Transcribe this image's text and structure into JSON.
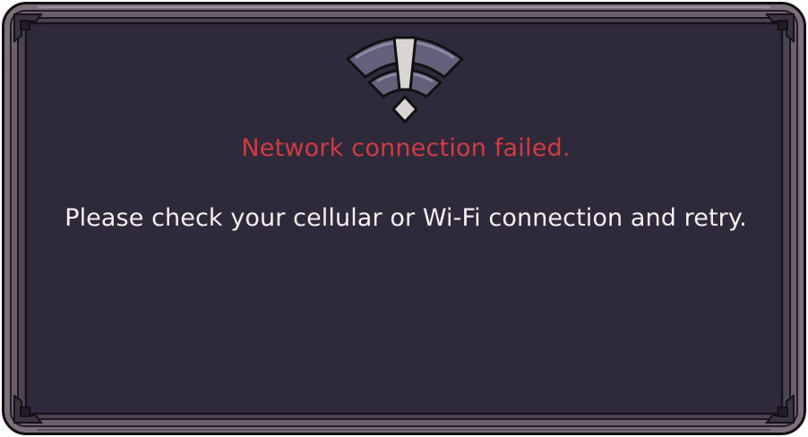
{
  "dialog": {
    "title": "Network connection failed.",
    "message": "Please check your cellular or Wi-Fi connection and retry.",
    "icon": "wifi-error-icon"
  },
  "colors": {
    "panel_background": "#2e2a3c",
    "frame_outer": "#7c6f7b",
    "frame_inner": "#4d4452",
    "title_text": "#d23b3f",
    "message_text": "#f3f0ee",
    "icon_arc": "#64607b",
    "icon_mark": "#d8d5d3"
  }
}
